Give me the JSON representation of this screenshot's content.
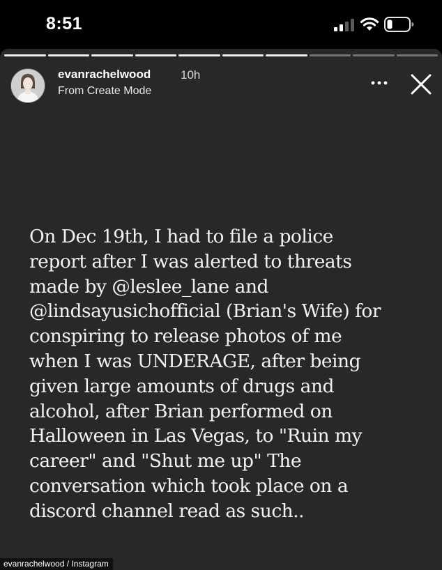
{
  "status_bar": {
    "time": "8:51",
    "signal": "signal-bars-icon",
    "wifi": "wifi-icon",
    "battery": "battery-low-icon"
  },
  "story": {
    "progress_total": 10,
    "progress_done": 7,
    "header": {
      "username": "evanrachelwood",
      "time_ago": "10h",
      "subtitle": "From Create Mode",
      "more_icon": "more-horizontal-icon",
      "close_icon": "close-icon"
    },
    "body_text": "On Dec 19th, I had to file a police\nreport after I was alerted to threats\nmade by @leslee_lane and\n@lindsayusichofficial (Brian's Wife) for\nconspiring to release photos of me\nwhen I was UNDERAGE, after being\ngiven large amounts of drugs and\nalcohol, after Brian performed on\nHalloween in Las Vegas, to \"Ruin my\ncareer\" and \"Shut me up\" The\nconversation which took place on a\ndiscord channel read as such..",
    "background_color": "#282828",
    "text_color": "#f2f2f2"
  },
  "credit": "evanrachelwood / Instagram"
}
